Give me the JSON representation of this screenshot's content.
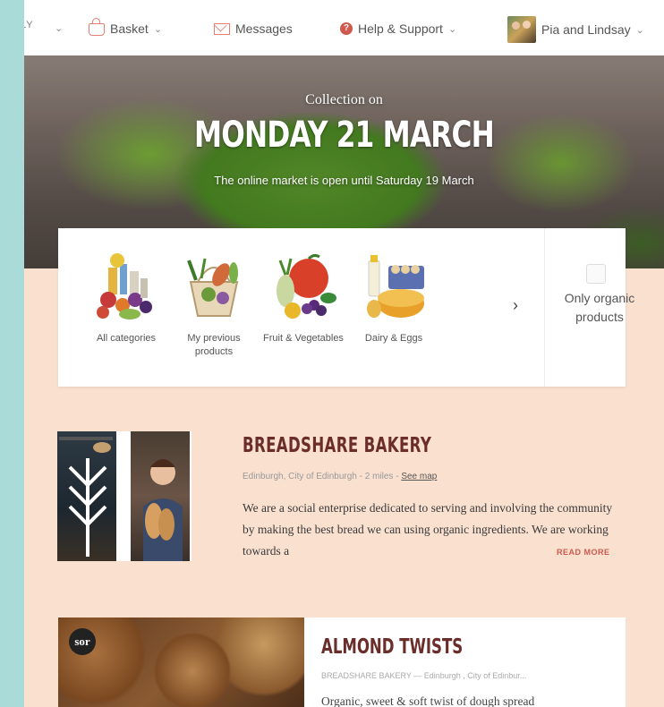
{
  "nav": {
    "cut_label": "LY",
    "basket": "Basket",
    "messages": "Messages",
    "help": "Help & Support",
    "user": "Pia and Lindsay"
  },
  "hero": {
    "collection_label": "Collection on",
    "date": "MONDAY 21 MARCH",
    "note": "The online market is open until Saturday 19 March"
  },
  "categories": [
    {
      "label": "All categories"
    },
    {
      "label": "My previous products"
    },
    {
      "label": "Fruit & Vegetables"
    },
    {
      "label": "Dairy & Eggs"
    }
  ],
  "organic_filter": {
    "label": "Only organic products",
    "checked": false
  },
  "producer": {
    "name": "BREADSHARE BAKERY",
    "location": "Edinburgh, City of Edinburgh - 2 miles - ",
    "map_link": "See map",
    "description": "We are a social enterprise dedicated to serving and involving the community by making the best bread we can using organic ingredients. We are working towards a",
    "read_more": "READ MORE"
  },
  "product": {
    "badge": "sor",
    "name": "ALMOND TWISTS",
    "meta": "BREADSHARE BAKERY — Edinburgh , City of Edinbur...",
    "description": "Organic, sweet & soft twist of dough spread"
  },
  "colors": {
    "accent": "#d0594e",
    "title": "#6a2d2a",
    "page_bg": "#f9e0cf",
    "frame_bg": "#a9dcd9"
  }
}
